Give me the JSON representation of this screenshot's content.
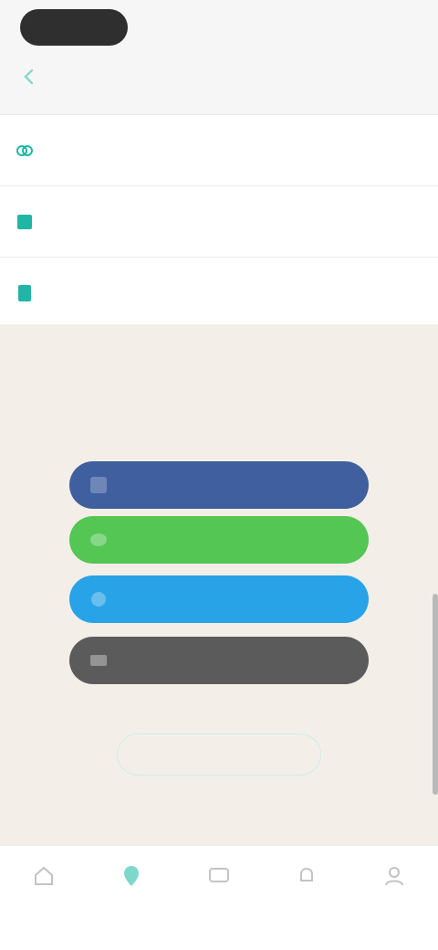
{
  "status": {
    "time": ""
  },
  "header": {
    "title": ""
  },
  "menu": {
    "items": [
      {
        "label": "",
        "icon": "link-icon"
      },
      {
        "label": "",
        "icon": "edit-icon"
      },
      {
        "label": "",
        "icon": "document-icon"
      }
    ]
  },
  "promo": {
    "title": "",
    "subtitle": "",
    "buttons": [
      {
        "label": "",
        "icon": "facebook-icon",
        "color": "#3f5f9f"
      },
      {
        "label": "",
        "icon": "line-icon",
        "color": "#53c653"
      },
      {
        "label": "",
        "icon": "twitter-icon",
        "color": "#29a3e7"
      },
      {
        "label": "",
        "icon": "mail-icon",
        "color": "#5b5b5b"
      }
    ],
    "outline_button": "",
    "link": ""
  },
  "bottom_nav": {
    "items": [
      {
        "label": "",
        "icon": "home-icon"
      },
      {
        "label": "",
        "icon": "location-pin-icon",
        "active": true
      },
      {
        "label": "",
        "icon": "chat-icon"
      },
      {
        "label": "",
        "icon": "bell-icon"
      },
      {
        "label": "",
        "icon": "person-icon"
      }
    ],
    "accent": "#1fb6a6"
  }
}
